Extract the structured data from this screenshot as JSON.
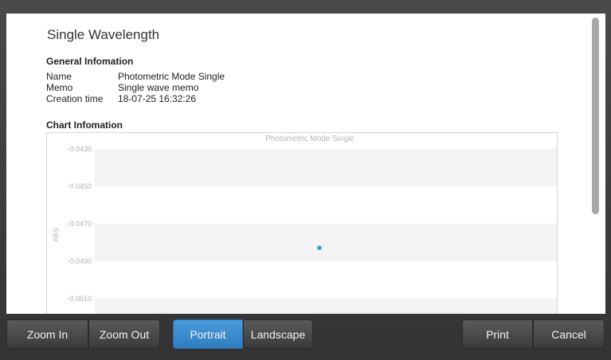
{
  "document": {
    "title": "Single Wavelength",
    "general_section_title": "General Infomation",
    "info": [
      {
        "key": "Name",
        "value": "Photometric Mode Single"
      },
      {
        "key": "Memo",
        "value": "Single wave memo"
      },
      {
        "key": "Creation time",
        "value": "18-07-25 16:32:26"
      }
    ],
    "chart_section_title": "Chart Infomation"
  },
  "chart_data": {
    "type": "scatter",
    "title": "Photometric Mode Single",
    "ylabel": "ABS",
    "xlabel": "",
    "yticks": [
      "-0.0430",
      "-0.0450",
      "-0.0470",
      "-0.0490",
      "-0.0510"
    ],
    "ylim": [
      -0.0515,
      -0.043
    ],
    "points": [
      {
        "x": 0.5,
        "y": -0.0482
      }
    ],
    "xlim": [
      0,
      1
    ],
    "point_color": "#29a9d6",
    "band_color": "#f3f3f3"
  },
  "toolbar": {
    "zoom_in": "Zoom In",
    "zoom_out": "Zoom Out",
    "portrait": "Portrait",
    "landscape": "Landscape",
    "print": "Print",
    "cancel": "Cancel",
    "active_orientation": "Portrait"
  }
}
